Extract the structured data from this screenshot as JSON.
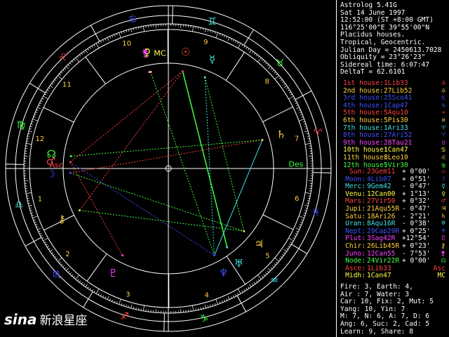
{
  "header": [
    "Astrolog 5.41G",
    "Sat 14 June 1997",
    "12:52:00 (ST +8:00 GMT)",
    "116°25'00\"E 39°55'00\"N",
    "Placidus houses.",
    "Tropical, Geocentric.",
    "Julian Day = 2450613.7028",
    "Obliquity = 23°26'23\"",
    "Sidereal time: 6:07:47",
    "DeltaT = 62.6101"
  ],
  "houses": [
    {
      "label": "1st house:",
      "pos": "1Lib33",
      "color": "#ff4040",
      "glyph": "♎"
    },
    {
      "label": "2nd house:",
      "pos": "27Lib52",
      "color": "#ffd040",
      "glyph": "♎"
    },
    {
      "label": "3rd house:",
      "pos": "25Sco41",
      "color": "#4050ff",
      "glyph": "♏"
    },
    {
      "label": "4th house:",
      "pos": "1Cap47",
      "color": "#4050ff",
      "glyph": "♑"
    },
    {
      "label": "5th house:",
      "pos": "5Aqu10",
      "color": "#ff4040",
      "glyph": "♒"
    },
    {
      "label": "6th house:",
      "pos": "5Pis30",
      "color": "#ffd040",
      "glyph": "♓"
    },
    {
      "label": "7th house:",
      "pos": "1Ari33",
      "color": "#40e0e0",
      "glyph": "♈"
    },
    {
      "label": "8th house:",
      "pos": "27Ari52",
      "color": "#4050ff",
      "glyph": "♈"
    },
    {
      "label": "9th house:",
      "pos": "28Tau21",
      "color": "#ff40ff",
      "glyph": "♉"
    },
    {
      "label": "10th house:",
      "pos": "1Can47",
      "color": "#ffff40",
      "glyph": "♋"
    },
    {
      "label": "11th house:",
      "pos": "8Leo10",
      "color": "#ffd040",
      "glyph": "♌"
    },
    {
      "label": "12th house:",
      "pos": "5Vir30",
      "color": "#40ff40",
      "glyph": "♍"
    }
  ],
  "planets": [
    {
      "name": "Sun:",
      "pos": "23Gem11",
      "rate": "+ 0°00'",
      "color": "#ff4040",
      "glyph": "☉"
    },
    {
      "name": "Moon:",
      "pos": "4Lib07",
      "rate": "+ 0°51'",
      "color": "#4050ff",
      "glyph": "☽"
    },
    {
      "name": "Merc:",
      "pos": "9Gem42",
      "rate": "- 0°47'",
      "color": "#40e0e0",
      "glyph": "☿"
    },
    {
      "name": "Venu:",
      "pos": "12Can00",
      "rate": "+ 1°13'",
      "color": "#ffff40",
      "glyph": "♀"
    },
    {
      "name": "Mars:",
      "pos": "27Vir50",
      "rate": "+ 0°32'",
      "color": "#ff4040",
      "glyph": "♂"
    },
    {
      "name": "Jupi:",
      "pos": "21Aqu55R",
      "rate": "- 0°47'",
      "color": "#ffd040",
      "glyph": "♃"
    },
    {
      "name": "Satu:",
      "pos": "18Ari26",
      "rate": "- 2°21'",
      "color": "#ffd040",
      "glyph": "♄"
    },
    {
      "name": "Uran:",
      "pos": "8Aqu16R",
      "rate": "- 0°38'",
      "color": "#40e0e0",
      "glyph": "♅"
    },
    {
      "name": "Nept:",
      "pos": "29Cap29R",
      "rate": "+ 0°25'",
      "color": "#4050ff",
      "glyph": "♆"
    },
    {
      "name": "Plut:",
      "pos": "3Sag42R",
      "rate": "+12°54'",
      "color": "#ff40ff",
      "glyph": "♇"
    },
    {
      "name": "Chir:",
      "pos": "26Lib45R",
      "rate": "+ 0°23'",
      "color": "#ffd040",
      "glyph": "⚷"
    },
    {
      "name": "Juno:",
      "pos": "12Can55",
      "rate": "- 7°53'",
      "color": "#ff40ff",
      "glyph": "⚵"
    },
    {
      "name": "Node:",
      "pos": "24Vir22R",
      "rate": "+ 0°00'",
      "color": "#40ff40",
      "glyph": "☊"
    },
    {
      "name": "Asce:",
      "pos": "1Lib33",
      "rate": "",
      "color": "#ff4040",
      "glyph": "Asc"
    },
    {
      "name": "Midh:",
      "pos": "1Can47",
      "rate": "",
      "color": "#ffff40",
      "glyph": "MC"
    }
  ],
  "stats": [
    "Fire: 3, Earth: 4,",
    "Air : 7, Water: 3",
    "Car: 10, Fix: 2, Mut: 5",
    "Yang: 10, Yin: 7",
    "M: 7, N: 6, A: 7, D: 6",
    "Ang: 6, Suc: 2, Cad: 5",
    "Learn: 9, Share: 8"
  ],
  "wheel": {
    "cusp_numbers": [
      "1",
      "2",
      "3",
      "4",
      "5",
      "6",
      "7",
      "8",
      "9",
      "10",
      "11",
      "12"
    ],
    "sign_glyphs": [
      "♈",
      "♉",
      "♊",
      "♋",
      "♌",
      "♍",
      "♎",
      "♏",
      "♐",
      "♑",
      "♒",
      "♓"
    ],
    "sign_colors": [
      "#ff4040",
      "#40ff40",
      "#40e0e0",
      "#4050ff",
      "#ff4040",
      "#40ff40",
      "#40e0e0",
      "#4050ff",
      "#ff4040",
      "#40ff40",
      "#40e0e0",
      "#4050ff"
    ],
    "asc_label": "Asc",
    "mc_label": "MC",
    "des_label": "Des",
    "planet_glyphs": [
      {
        "glyph": "☉",
        "color": "#ff4040"
      },
      {
        "glyph": "☿",
        "color": "#40e0e0"
      },
      {
        "glyph": "♀",
        "color": "#ffff40"
      },
      {
        "glyph": "☽",
        "color": "#4050ff"
      },
      {
        "glyph": "⚷",
        "color": "#ffd040"
      },
      {
        "glyph": "♂",
        "color": "#ff4040"
      },
      {
        "glyph": "☊",
        "color": "#40ff40"
      },
      {
        "glyph": "♃",
        "color": "#ffd040"
      },
      {
        "glyph": "♅",
        "color": "#40e0e0"
      },
      {
        "glyph": "♆",
        "color": "#4050ff"
      },
      {
        "glyph": "♇",
        "color": "#ff40ff"
      },
      {
        "glyph": "♄",
        "color": "#ffd040"
      },
      {
        "glyph": "⚵",
        "color": "#ff40ff"
      }
    ]
  },
  "logo": {
    "brand": "sina",
    "text": "新浪星座"
  }
}
